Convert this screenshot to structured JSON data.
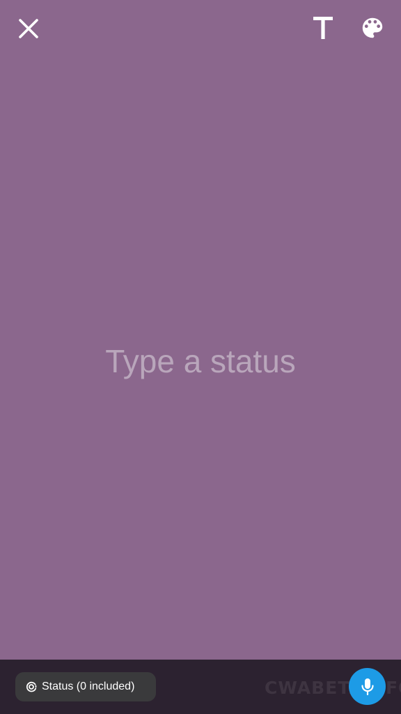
{
  "composer": {
    "placeholder": "Type a status",
    "background_color": "#8b678d"
  },
  "toolbar": {
    "close_icon": "close-icon",
    "text_label": "T",
    "palette_icon": "palette-icon"
  },
  "footer": {
    "audience_label": "Status (0 included)",
    "audience_icon": "status-ring-icon",
    "watermark": "CWABETAINFO",
    "mic_icon": "microphone-icon",
    "mic_color": "#1d9be6"
  }
}
